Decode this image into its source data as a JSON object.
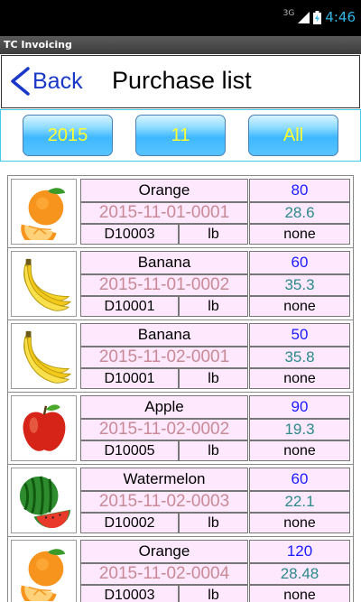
{
  "status_bar": {
    "signal": "3G",
    "time": "4:46"
  },
  "app": {
    "title": "TC Invoicing"
  },
  "header": {
    "back_label": "Back",
    "title": "Purchase list"
  },
  "filters": {
    "year": "2015",
    "month": "11",
    "scope": "All"
  },
  "purchases": [
    {
      "fruit_icon": "orange-icon",
      "name": "Orange",
      "code": "2015-11-01-0001",
      "supplier": "D10003",
      "unit": "lb",
      "quantity": "80",
      "price": "28.6",
      "note": "none"
    },
    {
      "fruit_icon": "banana-icon",
      "name": "Banana",
      "code": "2015-11-01-0002",
      "supplier": "D10001",
      "unit": "lb",
      "quantity": "60",
      "price": "35.3",
      "note": "none"
    },
    {
      "fruit_icon": "banana-icon",
      "name": "Banana",
      "code": "2015-11-02-0001",
      "supplier": "D10001",
      "unit": "lb",
      "quantity": "50",
      "price": "35.8",
      "note": "none"
    },
    {
      "fruit_icon": "apple-icon",
      "name": "Apple",
      "code": "2015-11-02-0002",
      "supplier": "D10005",
      "unit": "lb",
      "quantity": "90",
      "price": "19.3",
      "note": "none"
    },
    {
      "fruit_icon": "watermelon-icon",
      "name": "Watermelon",
      "code": "2015-11-02-0003",
      "supplier": "D10002",
      "unit": "lb",
      "quantity": "60",
      "price": "22.1",
      "note": "none"
    },
    {
      "fruit_icon": "orange-icon",
      "name": "Orange",
      "code": "2015-11-02-0004",
      "supplier": "D10003",
      "unit": "lb",
      "quantity": "120",
      "price": "28.48",
      "note": "none"
    }
  ]
}
